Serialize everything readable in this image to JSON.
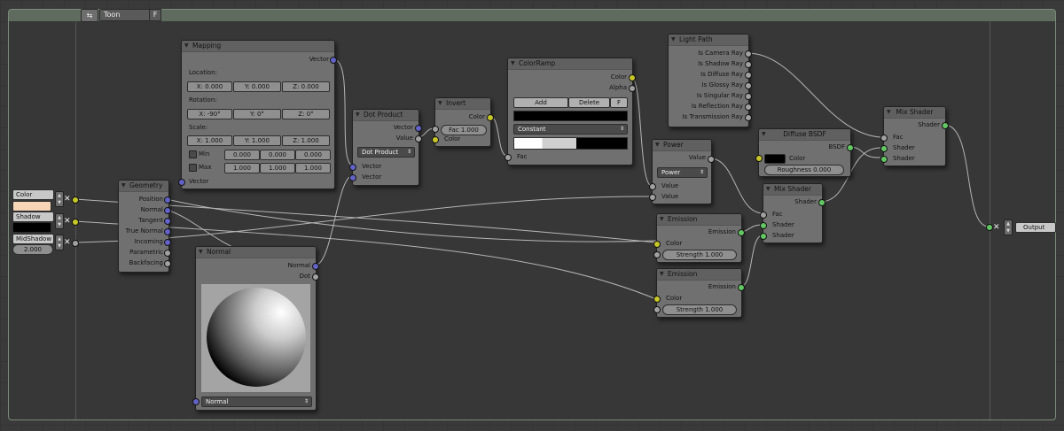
{
  "group": {
    "icon": "link-icon",
    "name": "Toon",
    "fake_user": "F"
  },
  "inputs": [
    {
      "label": "Color",
      "color": "#f7d6b8"
    },
    {
      "label": "Shadow",
      "color": "#000000"
    },
    {
      "label": "MidShadow",
      "value": "2.000"
    }
  ],
  "output": {
    "label": "Output"
  },
  "nodes": {
    "geometry": {
      "title": "Geometry",
      "outputs": [
        "Position",
        "Normal",
        "Tangent",
        "True Normal",
        "Incoming",
        "Parametric",
        "Backfacing"
      ]
    },
    "mapping": {
      "title": "Mapping",
      "out": "Vector",
      "location_label": "Location:",
      "location": [
        "X: 0.000",
        "Y: 0.000",
        "Z: 0.000"
      ],
      "rotation_label": "Rotation:",
      "rotation": [
        "X: -90°",
        "Y: 0°",
        "Z: 0°"
      ],
      "scale_label": "Scale:",
      "scale": [
        "X: 1.000",
        "Y: 1.000",
        "Z: 1.000"
      ],
      "min_label": "Min",
      "min": [
        "0.000",
        "0.000",
        "0.000"
      ],
      "max_label": "Max",
      "max": [
        "1.000",
        "1.000",
        "1.000"
      ],
      "in": "Vector"
    },
    "normal": {
      "title": "Normal",
      "outputs": [
        "Normal",
        "Dot"
      ],
      "select": "Normal"
    },
    "dot": {
      "title": "Dot Product",
      "outputs": [
        "Vector",
        "Value"
      ],
      "mode": "Dot Product",
      "inputs": [
        "Vector",
        "Vector"
      ]
    },
    "invert": {
      "title": "Invert",
      "out": "Color",
      "fac": "Fac 1.000",
      "in": "Color"
    },
    "ramp": {
      "title": "ColorRamp",
      "outputs": [
        "Color",
        "Alpha"
      ],
      "add": "Add",
      "delete": "Delete",
      "f": "F",
      "interp": "Constant",
      "in": "Fac"
    },
    "lightpath": {
      "title": "Light Path",
      "outputs": [
        "Is Camera Ray",
        "Is Shadow Ray",
        "Is Diffuse Ray",
        "Is Glossy Ray",
        "Is Singular Ray",
        "Is Reflection Ray",
        "Is Transmission Ray"
      ]
    },
    "power": {
      "title": "Power",
      "out": "Value",
      "mode": "Power",
      "inputs": [
        "Value",
        "Value"
      ]
    },
    "diffuse": {
      "title": "Diffuse BSDF",
      "out": "BSDF",
      "color": "Color",
      "roughness": "Roughness 0.000"
    },
    "mix1": {
      "title": "Mix Shader",
      "out": "Shader",
      "inputs": [
        "Fac",
        "Shader",
        "Shader"
      ]
    },
    "mix2": {
      "title": "Mix Shader",
      "out": "Shader",
      "inputs": [
        "Fac",
        "Shader",
        "Shader"
      ]
    },
    "emission1": {
      "title": "Emission",
      "out": "Emission",
      "color": "Color",
      "strength": "Strength 1.000"
    },
    "emission2": {
      "title": "Emission",
      "out": "Emission",
      "color": "Color",
      "strength": "Strength 1.000"
    }
  },
  "colors": {
    "vector_socket": "#6363c7",
    "color_socket": "#c7c729",
    "value_socket": "#a1a1a1",
    "shader_socket": "#63c763"
  }
}
